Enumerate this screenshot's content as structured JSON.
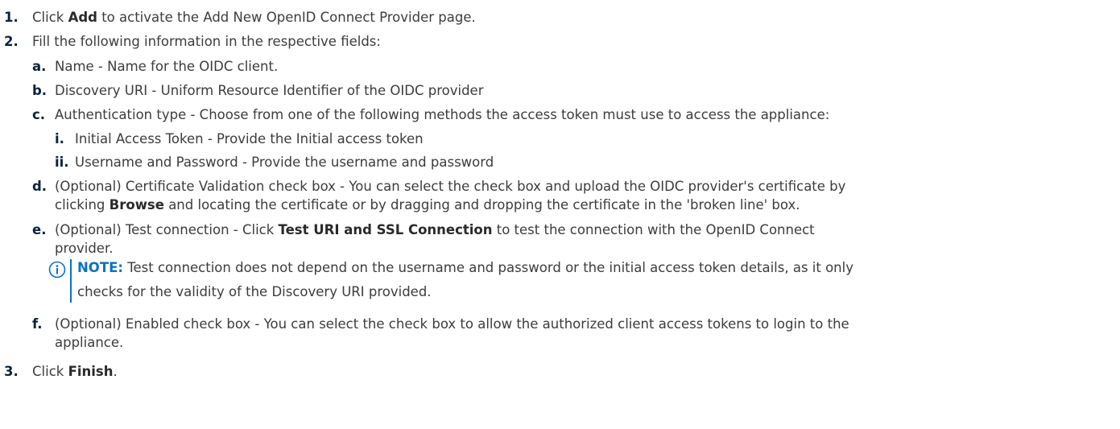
{
  "steps": [
    {
      "marker": "1.",
      "pre": "Click ",
      "bold": "Add",
      "post": " to activate the Add New OpenID Connect Provider page."
    },
    {
      "marker": "2.",
      "text": "Fill the following information in the respective fields:"
    },
    {
      "marker": "3.",
      "pre": "Click ",
      "bold": "Finish",
      "post": "."
    }
  ],
  "substeps": {
    "a": {
      "marker": "a.",
      "text": "Name - Name for the OIDC client."
    },
    "b": {
      "marker": "b.",
      "text": "Discovery URI - Uniform Resource Identifier of the OIDC provider"
    },
    "c": {
      "marker": "c.",
      "text": "Authentication type - Choose from one of the following methods the access token must use to access the appliance:"
    },
    "c_i": {
      "marker": "i.",
      "text": "Initial Access Token - Provide the Initial access token"
    },
    "c_ii": {
      "marker": "ii.",
      "text": "Username and Password - Provide the username and password"
    },
    "d": {
      "marker": "d.",
      "line1": "(Optional) Certificate Validation check box - You can select the check box and upload the OIDC provider's certificate by",
      "line2_pre": "clicking ",
      "line2_bold": "Browse",
      "line2_post": " and locating the certificate or by dragging and dropping the certificate in the 'broken line' box."
    },
    "e": {
      "marker": "e.",
      "line1_pre": "(Optional) Test connection - Click ",
      "line1_bold": "Test URI and SSL Connection",
      "line1_post": " to test the connection with the OpenID Connect",
      "line2": "provider."
    },
    "f": {
      "marker": "f.",
      "line1": "(Optional) Enabled check box - You can select the check box to allow the authorized client access tokens to login to the",
      "line2": "appliance."
    }
  },
  "note": {
    "label": "NOTE:",
    "line1": " Test connection does not depend on the username and password or the initial access token details, as it only",
    "line2": "checks for the validity of the Discovery URI provided.",
    "icon": "info-icon",
    "accent_color": "#0672cb"
  }
}
